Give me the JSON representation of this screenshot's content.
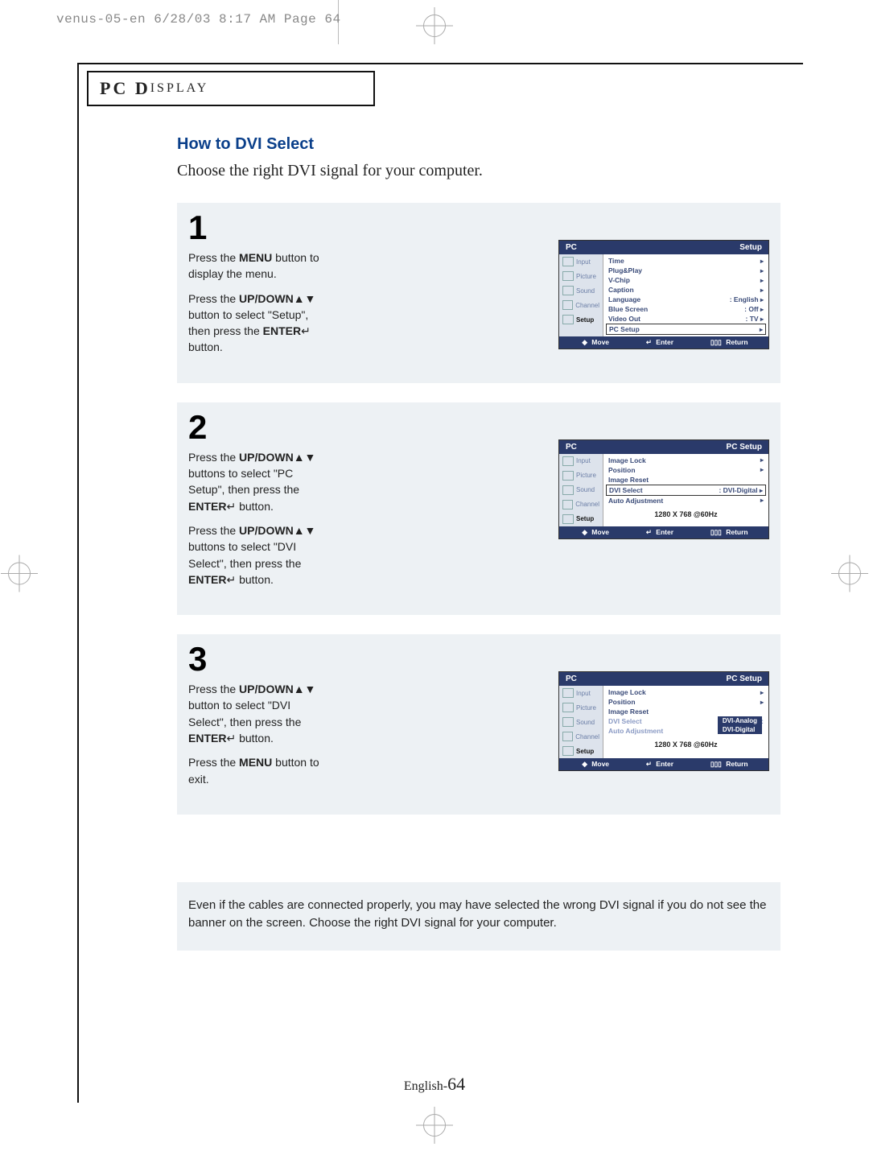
{
  "print_slug": "venus-05-en  6/28/03 8:17 AM  Page 64",
  "section_title_main": "PC D",
  "section_title_rest": "ISPLAY",
  "heading": "How to DVI Select",
  "intro": "Choose the right DVI signal for your computer.",
  "steps": {
    "s1": {
      "num": "1",
      "p1a": "Press the ",
      "p1b": "MENU",
      "p1c": " button to display the menu.",
      "p2a": "Press the ",
      "p2b": "UP/DOWN",
      "p2c": " button to select \"Setup\", then press the ",
      "p2d": "ENTER",
      "p2e": " button."
    },
    "s2": {
      "num": "2",
      "p1a": "Press the ",
      "p1b": "UP/DOWN",
      "p1c": " buttons to select \"PC Setup\", then press the ",
      "p1d": "ENTER",
      "p1e": " button.",
      "p2a": "Press the ",
      "p2b": "UP/DOWN",
      "p2c": " buttons to select \"DVI Select\", then press the ",
      "p2d": "ENTER",
      "p2e": " button."
    },
    "s3": {
      "num": "3",
      "p1a": "Press the ",
      "p1b": "UP/DOWN",
      "p1c": " button to select \"DVI Select\", then press the ",
      "p1d": "ENTER",
      "p1e": " button.",
      "p2a": "Press the ",
      "p2b": "MENU",
      "p2c": " button to exit."
    }
  },
  "osd_common": {
    "pc": "PC",
    "side": [
      "Input",
      "Picture",
      "Sound",
      "Channel",
      "Setup"
    ],
    "footer": {
      "move": "Move",
      "enter": "Enter",
      "return": "Return"
    }
  },
  "osd1": {
    "crumb": "Setup",
    "rows": [
      {
        "label": "Time",
        "val": "",
        "arrow": true
      },
      {
        "label": "Plug&Play",
        "val": "",
        "arrow": true
      },
      {
        "label": "V-Chip",
        "val": "",
        "arrow": true
      },
      {
        "label": "Caption",
        "val": "",
        "arrow": true
      },
      {
        "label": "Language",
        "val": ": English",
        "arrow": true
      },
      {
        "label": "Blue Screen",
        "val": ": Off",
        "arrow": true
      },
      {
        "label": "Video Out",
        "val": ": TV",
        "arrow": true
      },
      {
        "label": "PC Setup",
        "val": "",
        "arrow": true,
        "sel": true
      }
    ]
  },
  "osd2": {
    "crumb": "PC Setup",
    "rows": [
      {
        "label": "Image Lock",
        "val": "",
        "arrow": true
      },
      {
        "label": "Position",
        "val": "",
        "arrow": true
      },
      {
        "label": "Image Reset",
        "val": "",
        "arrow": false
      },
      {
        "label": "DVI Select",
        "val": ": DVI-Digital",
        "arrow": true,
        "sel": true
      },
      {
        "label": "Auto Adjustment",
        "val": "",
        "arrow": true
      }
    ],
    "resolution": "1280 X 768 @60Hz"
  },
  "osd3": {
    "crumb": "PC Setup",
    "rows": [
      {
        "label": "Image Lock",
        "val": "",
        "arrow": true
      },
      {
        "label": "Position",
        "val": "",
        "arrow": true
      },
      {
        "label": "Image Reset",
        "val": "",
        "arrow": false
      },
      {
        "label": "DVI Select",
        "val": ":",
        "arrow": false,
        "dim": true
      },
      {
        "label": "Auto Adjustment",
        "val": "",
        "arrow": false,
        "dim": true
      }
    ],
    "options": [
      "DVI-Analog",
      "DVI-Digital"
    ],
    "resolution": "1280 X 768 @60Hz"
  },
  "note": "Even if the cables are connected properly, you may have selected the wrong DVI signal if you do not see the banner on the screen. Choose the right DVI signal for your computer.",
  "footer_lang": "English-",
  "footer_page": "64"
}
